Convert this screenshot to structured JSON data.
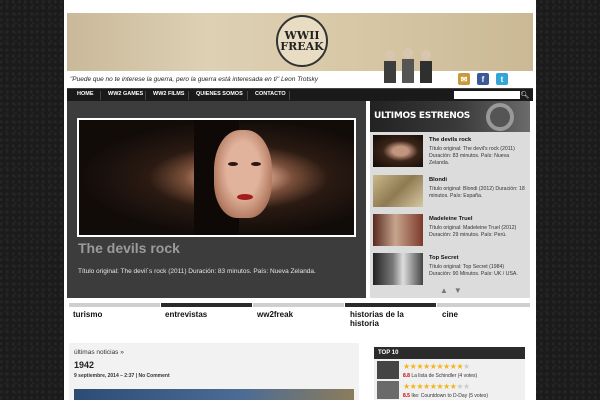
{
  "header": {
    "logo_line1": "WWII",
    "logo_line2": "FREAK",
    "quote": "\"Puede que no te interese la guerra, pero la guerra está interesada en ti\" Leon Trotsky",
    "social": [
      "email-icon",
      "facebook-icon",
      "twitter-icon"
    ]
  },
  "nav": {
    "items": [
      "HOME",
      "WW2 GAMES",
      "WW2 FILMS",
      "QUIENES SOMOS",
      "CONTACTO"
    ],
    "search_placeholder": "",
    "search_icon": "search-icon"
  },
  "featured": {
    "title": "The devils rock",
    "description": "Título original: The devil´s rock (2011) Duración: 83 minutos. País: Nueva Zelanda."
  },
  "sidebar": {
    "title": "ULTIMOS ESTRENOS",
    "movies": [
      {
        "title": "The devils rock",
        "desc": "Título original: The devil's rock (2011) Duración: 83 minutos. País: Nueva Zelanda."
      },
      {
        "title": "Blondi",
        "desc": "Título original: Blondi (2012) Duración: 18 minutos. País: España."
      },
      {
        "title": "Madeleine Truel",
        "desc": "Título original: Madeleine Truel (2012) Duración: 29 minutos. País: Perú."
      },
      {
        "title": "Top Secret",
        "desc": "Título original: Top Secret (1984) Duración: 90 Minutos. País: UK / USA."
      }
    ]
  },
  "categories": [
    "turismo",
    "entrevistas",
    "ww2freak",
    "historias de la historia",
    "cine"
  ],
  "news": {
    "heading": "últimas noticias »",
    "title": "1942",
    "meta": "9 septiembre, 2014 – 2:37 | No Comment"
  },
  "top10": {
    "title": "TOP 10",
    "items": [
      {
        "rating": "8.8",
        "text": "La lista de Schindler (4 votes)",
        "stars": 9
      },
      {
        "rating": "8.5",
        "text": "Ike: Countdown to D-Day (5 votes)",
        "stars": 8
      }
    ]
  },
  "colors": {
    "nav_bg": "#1a1a1a",
    "featured_bg": "#3c3c3c",
    "star": "#f3b51b",
    "accent_red": "#c00000"
  }
}
